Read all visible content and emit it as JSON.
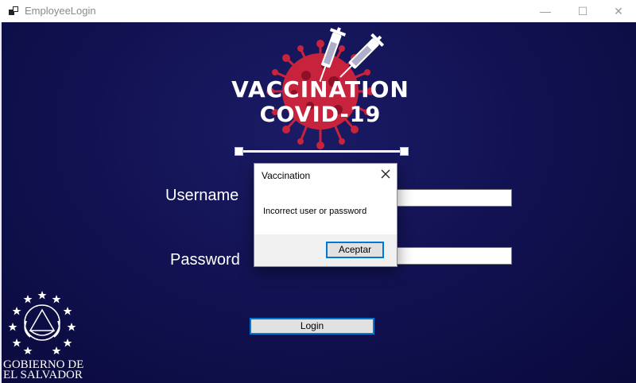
{
  "window": {
    "title": "EmployeeLogin",
    "minimize_glyph": "—",
    "maximize_glyph": "☐",
    "close_glyph": "✕"
  },
  "logo": {
    "line1": "VACCINATION",
    "line2": "COVID-19",
    "accent_color": "#c8233c"
  },
  "form": {
    "username_label": "Username",
    "username_value": "",
    "password_label": "Password",
    "password_value": "",
    "login_label": "Login"
  },
  "emblem": {
    "line1": "GOBIERNO DE",
    "line2": "EL SALVADOR"
  },
  "dialog": {
    "title": "Vaccination",
    "message": "Incorrect user or password",
    "ok_label": "Aceptar"
  },
  "colors": {
    "background": "#121253",
    "focus_border": "#0078d7"
  }
}
